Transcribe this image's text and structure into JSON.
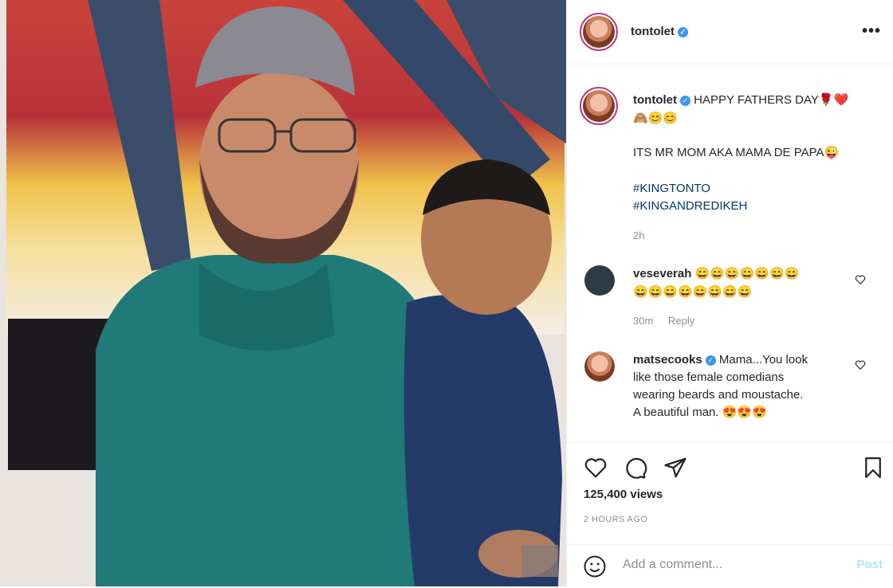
{
  "post": {
    "username": "tontolet",
    "verified_icon": "verified-badge-icon",
    "more_icon": "more-options-icon"
  },
  "caption": {
    "username": "tontolet",
    "line1": "HAPPY FATHERS DAY🌹❤️",
    "line2": "🙈😊😊",
    "line3": "ITS MR MOM AKA MAMA DE PAPA😜",
    "hashtag1": "#KINGTONTO",
    "hashtag2": "#KINGANDREDIKEH",
    "time": "2h"
  },
  "comments": [
    {
      "username": "veseverah",
      "line1": "😄😄😄😄😄😄😄",
      "line2": "😄😄😄😄😄😄😄😄",
      "time": "30m",
      "reply": "Reply"
    },
    {
      "username": "matsecooks",
      "line1": "Mama...You look",
      "line2": "like those female comedians",
      "line3": "wearing beards and moustache.",
      "line4": "A beautiful man. 😍😍😍"
    }
  ],
  "actions": {
    "views": "125,400 views",
    "posted": "2 HOURS AGO",
    "add_comment_placeholder": "Add a comment...",
    "post_label": "Post"
  },
  "colors": {
    "verified": "#3897f0",
    "hashtag": "#00376b",
    "muted": "#8e8e8e",
    "post_disabled": "#b2dffc"
  }
}
